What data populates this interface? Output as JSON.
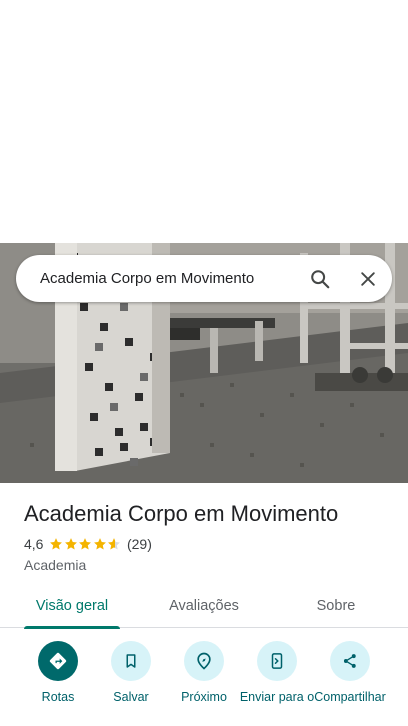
{
  "search": {
    "query": "Academia Corpo em Movimento",
    "search_icon": "search-icon",
    "close_icon": "close-icon"
  },
  "photo": {
    "subject": "gym-interior-photo"
  },
  "place": {
    "name": "Academia Corpo em Movimento",
    "rating": "4,6",
    "rating_value": 4.6,
    "review_count": "(29)",
    "category": "Academia"
  },
  "tabs": [
    {
      "label": "Visão geral",
      "active": true
    },
    {
      "label": "Avaliações",
      "active": false
    },
    {
      "label": "Sobre",
      "active": false
    }
  ],
  "actions": [
    {
      "label": "Rotas",
      "icon": "directions-icon"
    },
    {
      "label": "Salvar",
      "icon": "bookmark-icon"
    },
    {
      "label": "Próximo",
      "icon": "nearby-icon"
    },
    {
      "label": "Enviar para o",
      "icon": "send-to-phone-icon"
    },
    {
      "label": "Compartilhar",
      "icon": "share-icon"
    }
  ],
  "colors": {
    "accent": "#00796b",
    "action_bg": "#d7f3f8",
    "primary_action_bg": "#00696b",
    "star": "#f4b400"
  }
}
